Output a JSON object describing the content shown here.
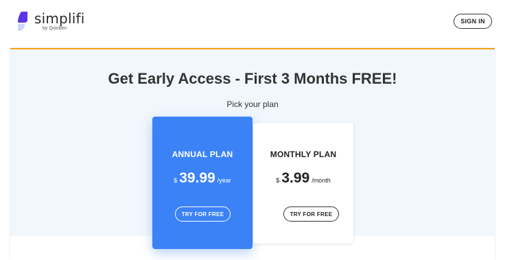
{
  "header": {
    "logo_name": "simplifi",
    "logo_sub": "by Quicken",
    "sign_in_label": "SIGN IN"
  },
  "main": {
    "headline": "Get Early Access - First 3 Months FREE!",
    "subhead": "Pick your plan",
    "plans": [
      {
        "name": "ANNUAL PLAN",
        "currency": "$",
        "price": "39.99",
        "period": "/year",
        "button_label": "TRY FOR FREE",
        "highlighted": true
      },
      {
        "name": "MONTHLY PLAN",
        "currency": "$",
        "price": "3.99",
        "period": "/month",
        "button_label": "TRY FOR FREE",
        "highlighted": false
      }
    ]
  },
  "colors": {
    "accent_blue": "#3b82f6",
    "top_border_orange": "#f2a21b",
    "panel_background": "#f1f7fc",
    "logo_purple": "#5b34e8",
    "logo_light": "#c9d7ff"
  },
  "icons": {
    "logo_mark": "simplifi-logo-icon"
  }
}
